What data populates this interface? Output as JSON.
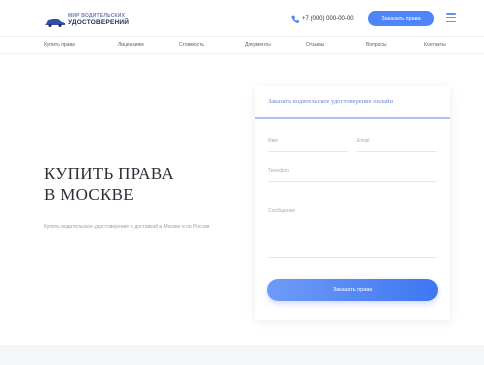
{
  "header": {
    "logo_top": "МИР ВОДИТЕЛЬСКИХ",
    "logo_bottom": "УДОСТОВЕРЕНИЙ",
    "phone": "+7 (000) 000-00-00",
    "cta_label": "Заказать права",
    "icons": {
      "logo": "car-icon",
      "phone": "phone-icon",
      "menu": "hamburger-menu-icon"
    },
    "accent_color": "#4d84f7"
  },
  "nav": {
    "items": [
      "Купить права",
      "Лицензиям",
      "Стоимость",
      "Документы",
      "Отзывы",
      "Вопросы",
      "Контакты"
    ]
  },
  "hero": {
    "title_line1": "КУПИТЬ ПРАВА",
    "title_line2": "В МОСКВЕ",
    "subtitle": "Купить водительское удостоверение с доставкой в Москве и по России"
  },
  "form": {
    "title": "Заказать водительское удостоверение онлайн",
    "name_label": "Имя",
    "email_label": "Email",
    "phone_label": "Телефон",
    "message_label": "Сообщение",
    "submit_label": "Заказать права"
  }
}
